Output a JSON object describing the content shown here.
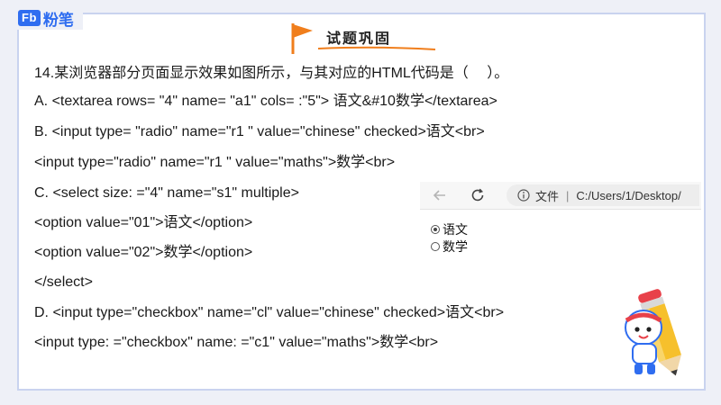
{
  "brand": {
    "badge": "Fb",
    "name": "粉笔"
  },
  "banner": {
    "title": "试题巩固"
  },
  "question": {
    "stem": "14.某浏览器部分页面显示效果如图所示，与其对应的HTML代码是（　 ）。",
    "lines": [
      "A. <textarea rows= \"4\" name= \"a1\" cols= :\"5\"> 语文&#10数学</textarea>",
      "B. <input type= \"radio\" name=\"r1 \" value=\"chinese\" checked>语文<br>",
      "<input type=\"radio\" name=\"r1 \" value=\"maths\">数学<br>",
      "C. <select size: =\"4\" name=\"s1\" multiple>",
      "<option value=\"01\">语文</option>",
      "<option value=\"02\">数学</option>",
      "</select>",
      "D. <input type=\"checkbox\" name=\"cl\" value=\"chinese\" checked>语文<br>",
      "<input type: =\"checkbox\" name: =\"c1\" value=\"maths\">数学<br>"
    ]
  },
  "browser": {
    "address_label": "文件",
    "address_path": "C:/Users/1/Desktop/",
    "options": [
      {
        "label": "语文",
        "checked": true
      },
      {
        "label": "数学",
        "checked": false
      }
    ]
  },
  "colors": {
    "brand": "#2f6df0",
    "frame_border": "#c9d3ef",
    "banner_flag": "#f07e1c"
  },
  "icons": [
    "back-arrow-icon",
    "reload-icon",
    "info-icon",
    "flag-icon",
    "pencil-mascot-icon"
  ]
}
